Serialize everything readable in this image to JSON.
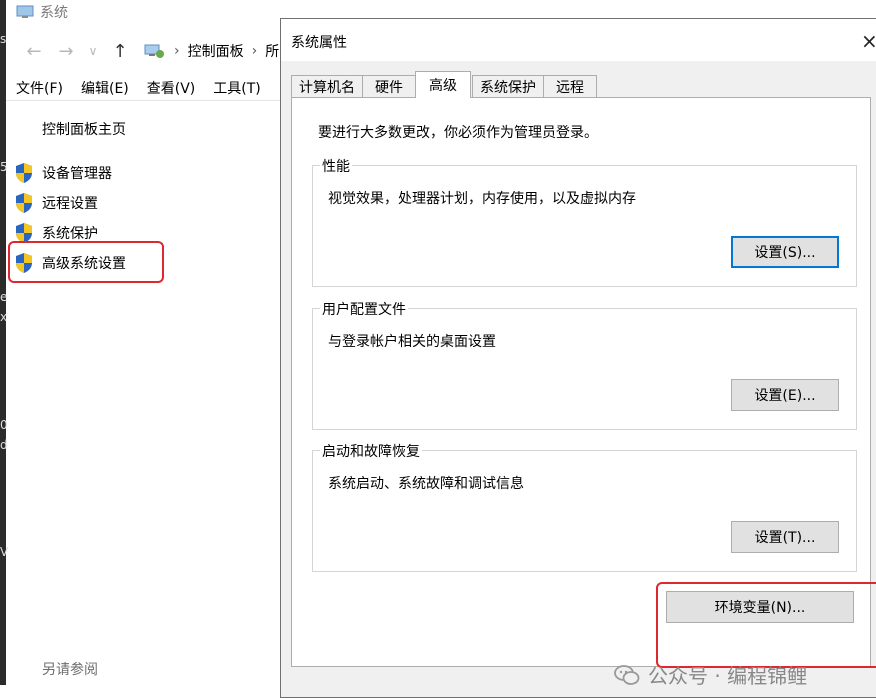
{
  "left_window": {
    "title": "系统",
    "address": {
      "root": "控制面板",
      "partial": "所"
    },
    "menu": [
      "文件(F)",
      "编辑(E)",
      "查看(V)",
      "工具(T)"
    ],
    "home_link": "控制面板主页",
    "links": [
      "设备管理器",
      "远程设置",
      "系统保护",
      "高级系统设置"
    ],
    "see_also": "另请参阅",
    "edge_fragments": [
      "s",
      "5",
      "e",
      "x",
      "0",
      "d",
      "V"
    ]
  },
  "dialog": {
    "title": "系统属性",
    "close_glyph": "×",
    "tabs": [
      "计算机名",
      "硬件",
      "高级",
      "系统保护",
      "远程"
    ],
    "active_tab": "高级",
    "admin_note": "要进行大多数更改，你必须作为管理员登录。",
    "groups": [
      {
        "label": "性能",
        "desc": "视觉效果，处理器计划，内存使用，以及虚拟内存",
        "button": "设置(S)..."
      },
      {
        "label": "用户配置文件",
        "desc": "与登录帐户相关的桌面设置",
        "button": "设置(E)..."
      },
      {
        "label": "启动和故障恢复",
        "desc": "系统启动、系统故障和调试信息",
        "button": "设置(T)..."
      }
    ],
    "env_button": "环境变量(N)..."
  },
  "watermark": {
    "text": "公众号 · 编程锦鲤"
  },
  "icons": {
    "shield": "uac-shield-icon",
    "app": "system-monitor-icon",
    "back": "arrow-left-icon",
    "forward": "arrow-right-icon",
    "up": "arrow-up-icon",
    "close": "close-icon"
  },
  "colors": {
    "highlight_box": "#e0262e",
    "default_button_border": "#0078d7",
    "dialog_background": "#f0f0f0"
  }
}
